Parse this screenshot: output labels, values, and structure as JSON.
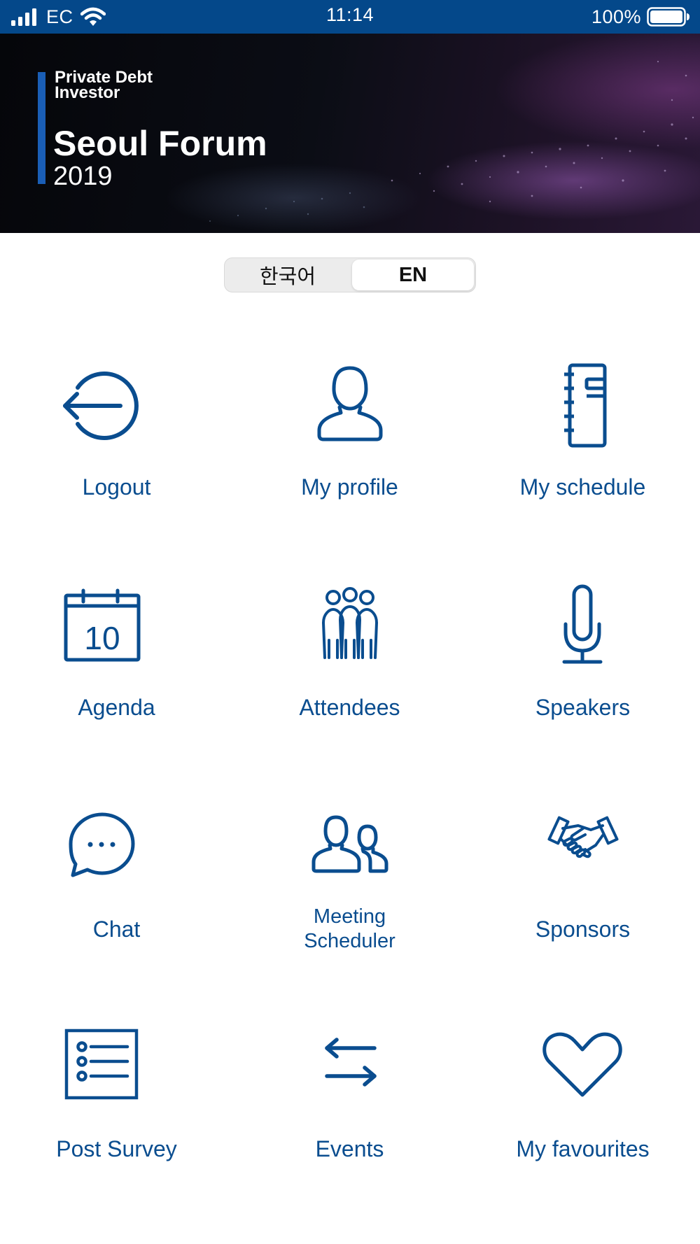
{
  "status_bar": {
    "carrier": "EC",
    "time": "11:14",
    "battery": "100%"
  },
  "banner": {
    "brand_line1": "Private Debt",
    "brand_line2": "Investor",
    "title": "Seoul Forum",
    "year": "2019"
  },
  "language": {
    "korean": "한국어",
    "english": "EN",
    "selected": "EN"
  },
  "menu": {
    "logout": "Logout",
    "my_profile": "My profile",
    "my_schedule": "My schedule",
    "agenda": "Agenda",
    "agenda_day": "10",
    "attendees": "Attendees",
    "speakers": "Speakers",
    "chat": "Chat",
    "meeting_scheduler_1": "Meeting",
    "meeting_scheduler_2": "Scheduler",
    "sponsors": "Sponsors",
    "post_survey": "Post Survey",
    "events": "Events",
    "my_favourites": "My favourites"
  },
  "colors": {
    "status_bar": "#04488a",
    "icon": "#0a4d8f",
    "banner_accent": "#1a5eb6"
  }
}
